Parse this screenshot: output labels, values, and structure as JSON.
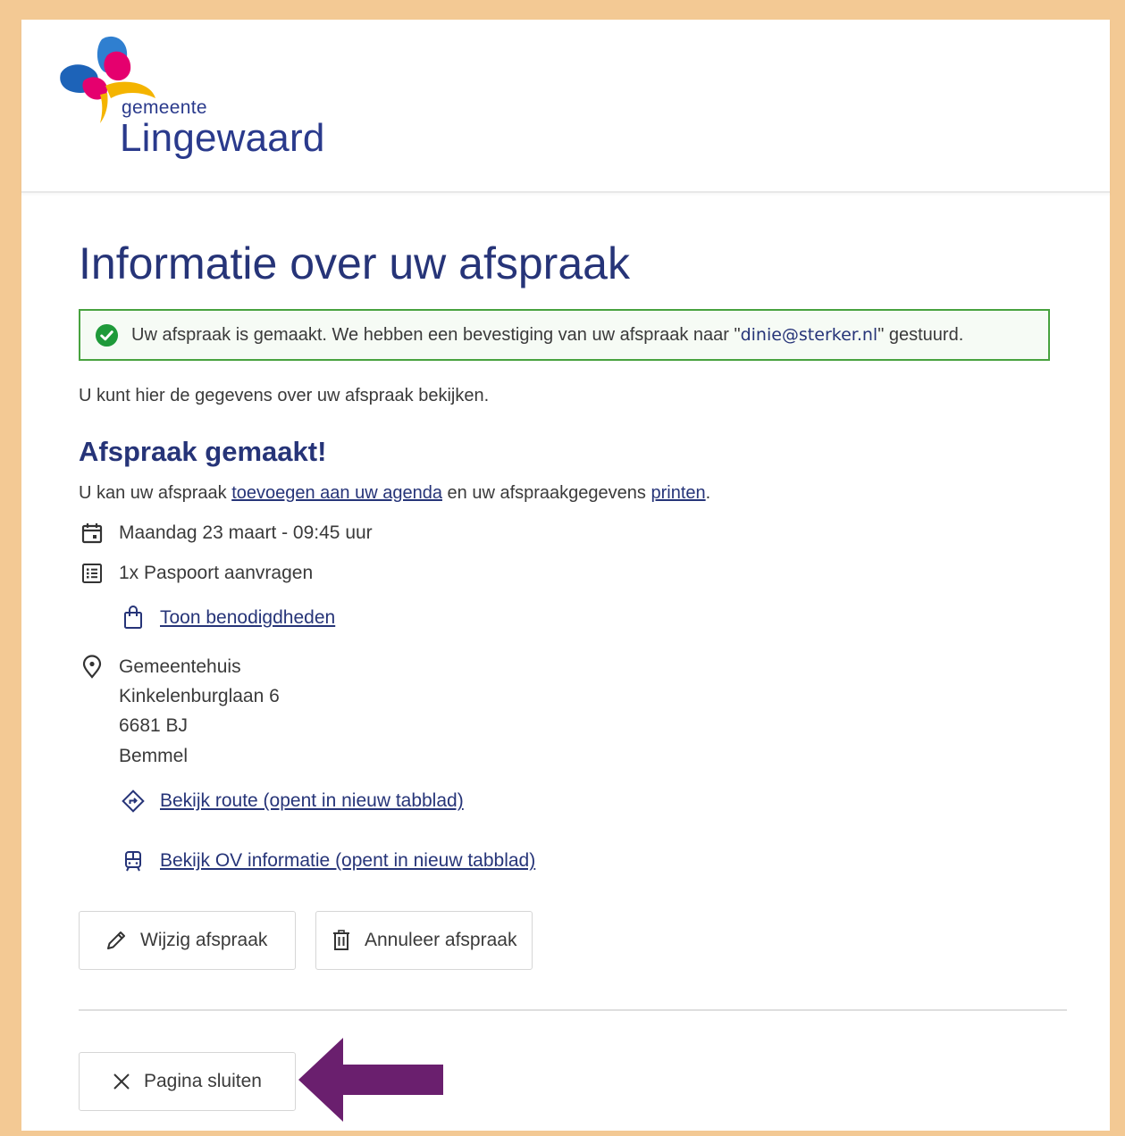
{
  "header": {
    "logo_small": "gemeente",
    "logo_name": "Lingewaard"
  },
  "page": {
    "title": "Informatie over uw afspraak"
  },
  "alert": {
    "text_before": "Uw afspraak is gemaakt. We hebben een bevestiging van uw afspraak naar \"",
    "email": "dinie@sterker.nl",
    "text_after": "\"  gestuurd."
  },
  "intro": "U kunt hier de gegevens over uw afspraak bekijken.",
  "appointment": {
    "heading": "Afspraak gemaakt!",
    "add_prefix": "U kan uw afspraak ",
    "agenda_link": "toevoegen aan uw agenda",
    "add_middle": " en uw afspraakgegevens ",
    "print_link": "printen",
    "add_suffix": ".",
    "datetime": "Maandag 23 maart - 09:45 uur",
    "product": "1x Paspoort aanvragen",
    "requirements_link": "Toon benodigdheden",
    "location": {
      "name": "Gemeentehuis",
      "street": "Kinkelenburglaan 6",
      "postcode": "6681 BJ",
      "city": "Bemmel"
    },
    "route_link": "Bekijk route (opent in nieuw tabblad)",
    "ov_link": "Bekijk OV informatie (opent in nieuw tabblad)"
  },
  "buttons": {
    "edit": "Wijzig afspraak",
    "cancel": "Annuleer afspraak",
    "close": "Pagina sluiten"
  },
  "icons": {
    "success": "check-circle-icon",
    "calendar": "calendar-icon",
    "list": "list-icon",
    "bag": "bag-icon",
    "location": "map-pin-icon",
    "route": "route-icon",
    "transit": "train-icon",
    "edit": "pencil-icon",
    "trash": "trash-icon",
    "close": "close-icon"
  },
  "colors": {
    "brand": "#263478",
    "success": "#48a23f",
    "frame": "#f3c994",
    "arrow": "#6a1f6e"
  }
}
